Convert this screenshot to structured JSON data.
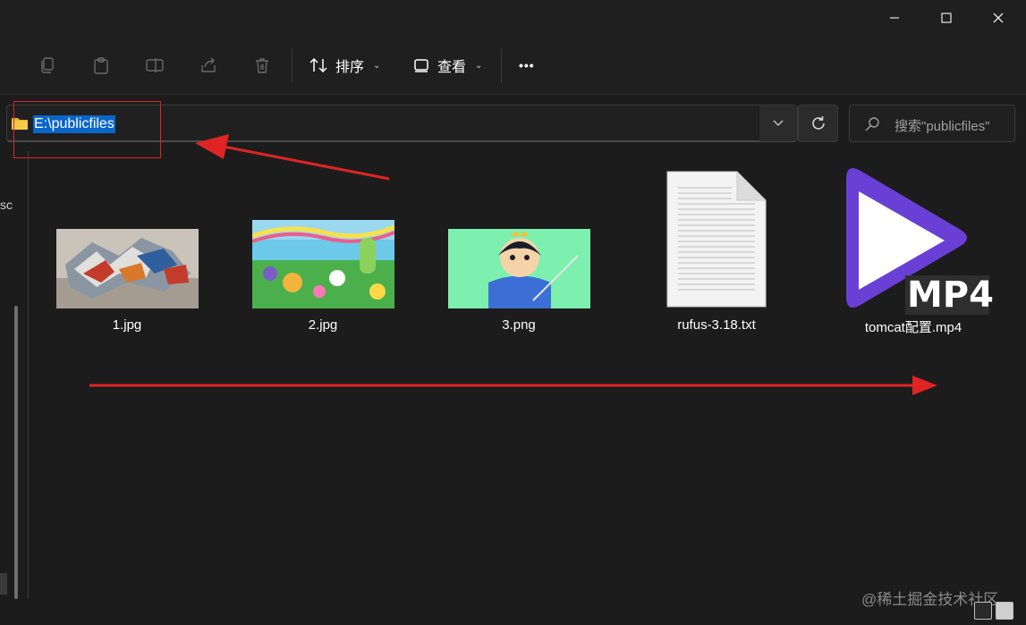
{
  "window": {
    "minimize_icon": "minimize-icon",
    "maximize_icon": "maximize-icon",
    "close_icon": "close-icon"
  },
  "toolbar": {
    "sort_label": "排序",
    "view_label": "查看",
    "more_label": "•••"
  },
  "address": {
    "path": "E:\\publicfiles"
  },
  "search": {
    "placeholder": "搜索\"publicfiles\""
  },
  "sidebar": {
    "fragment": "sc"
  },
  "files": [
    {
      "name": "1.jpg",
      "kind": "image"
    },
    {
      "name": "2.jpg",
      "kind": "image"
    },
    {
      "name": "3.png",
      "kind": "image"
    },
    {
      "name": "rufus-3.18.txt",
      "kind": "text"
    },
    {
      "name": "tomcat配置.mp4",
      "kind": "video"
    }
  ],
  "mp4_badge": "MP4",
  "watermark": "@稀土掘金技术社区",
  "colors": {
    "accent": "#0a67c9",
    "annotation": "#e02424",
    "mp4_purple": "#6a3fd6"
  }
}
